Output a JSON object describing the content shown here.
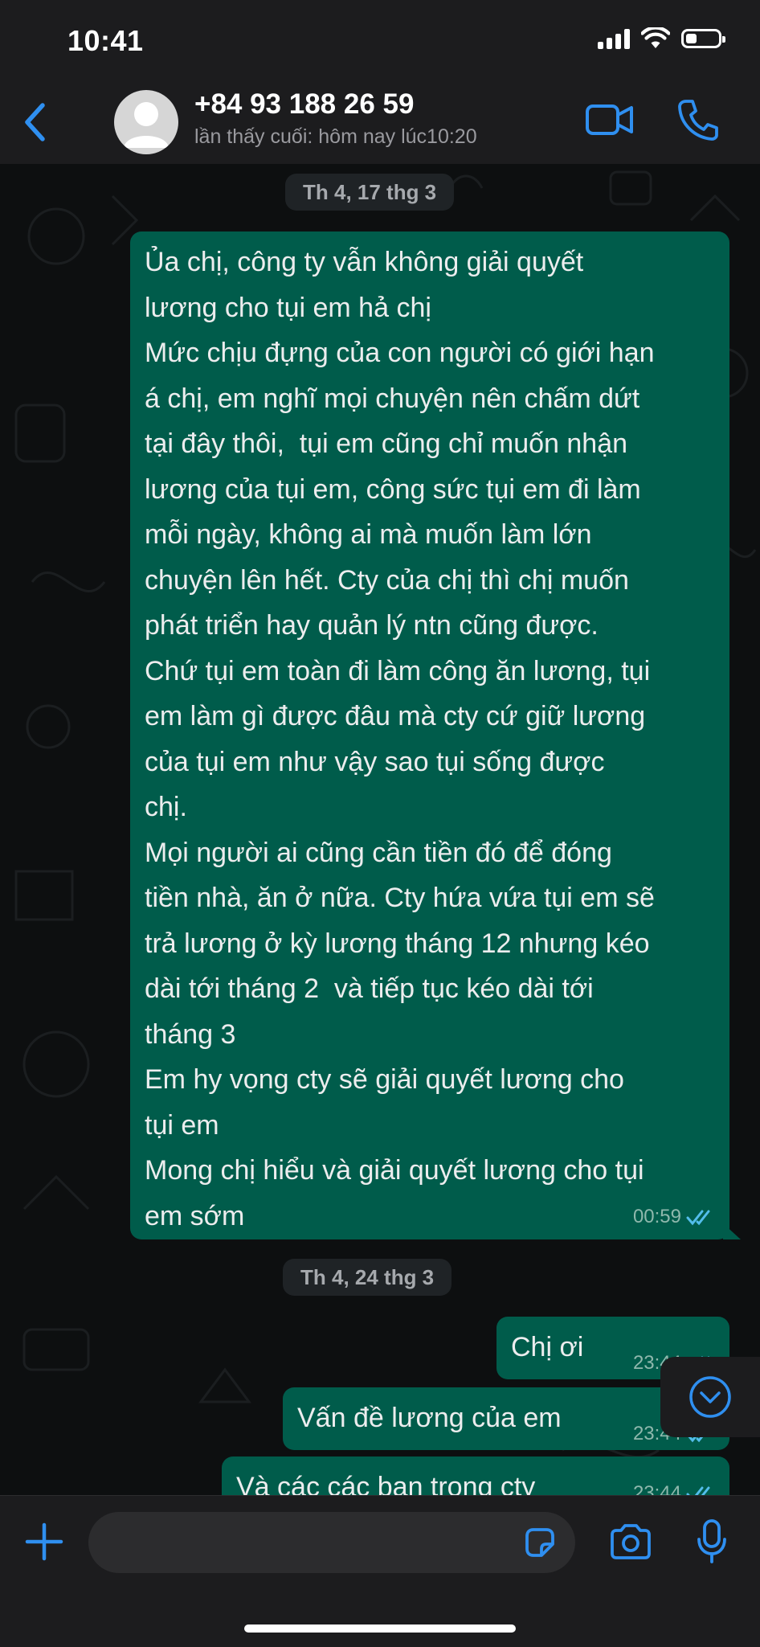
{
  "status_bar": {
    "time": "10:41",
    "battery_level": 0.35
  },
  "header": {
    "contact_name": "+84 93 188 26 59",
    "last_seen": "lần thấy cuối: hôm nay lúc10:20"
  },
  "chat": {
    "date_1": "Th 4, 17 thg 3",
    "message_1": {
      "text": "Ủa chị, công ty vẫn không giải quyết\nlương cho tụi em hả chị\nMức chịu đựng của con người có giới hạn\ná chị, em nghĩ mọi chuyện nên chấm dứt\ntại đây thôi,  tụi em cũng chỉ muốn nhận\nlương của tụi em, công sức tụi em đi làm\nmỗi ngày, không ai mà muốn làm lớn\nchuyện lên hết. Cty của chị thì chị muốn\nphát triển hay quản lý ntn cũng được.\nChứ tụi em toàn đi làm công ăn lương, tụi\nem làm gì được đâu mà cty cứ giữ lương\ncủa tụi em như vậy sao tụi sống được\nchị.\nMọi người ai cũng cần tiền đó để đóng\ntiền nhà, ăn ở nữa. Cty hứa vứa tụi em sẽ\ntrả lương ở kỳ lương tháng 12 nhưng kéo\ndài tới tháng 2  và tiếp tục kéo dài tới\ntháng 3\nEm hy vọng cty sẽ giải quyết lương cho\ntụi em\nMong chị hiểu và giải quyết lương cho tụi\nem sớm",
      "time": "00:59"
    },
    "date_2": "Th 4, 24 thg 3",
    "message_2": {
      "text": "Chị ơi",
      "time": "23:44"
    },
    "message_3": {
      "text": "Vấn đề lương của em",
      "time": "23:44"
    },
    "message_4": {
      "text": "Và các các bạn trong cty",
      "time": "23:44"
    }
  },
  "input_bar": {
    "placeholder": ""
  },
  "colors": {
    "accent": "#2f8ff0",
    "outgoing_bubble": "#005c4b",
    "read_ticks": "#53bdeb",
    "header_bg": "#1c1c1e"
  },
  "icons": [
    "back-chevron-icon",
    "avatar-placeholder-icon",
    "video-camera-icon",
    "phone-icon",
    "chevron-down-circle-icon",
    "plus-icon",
    "sticker-icon",
    "camera-icon",
    "microphone-icon",
    "double-check-icon"
  ]
}
